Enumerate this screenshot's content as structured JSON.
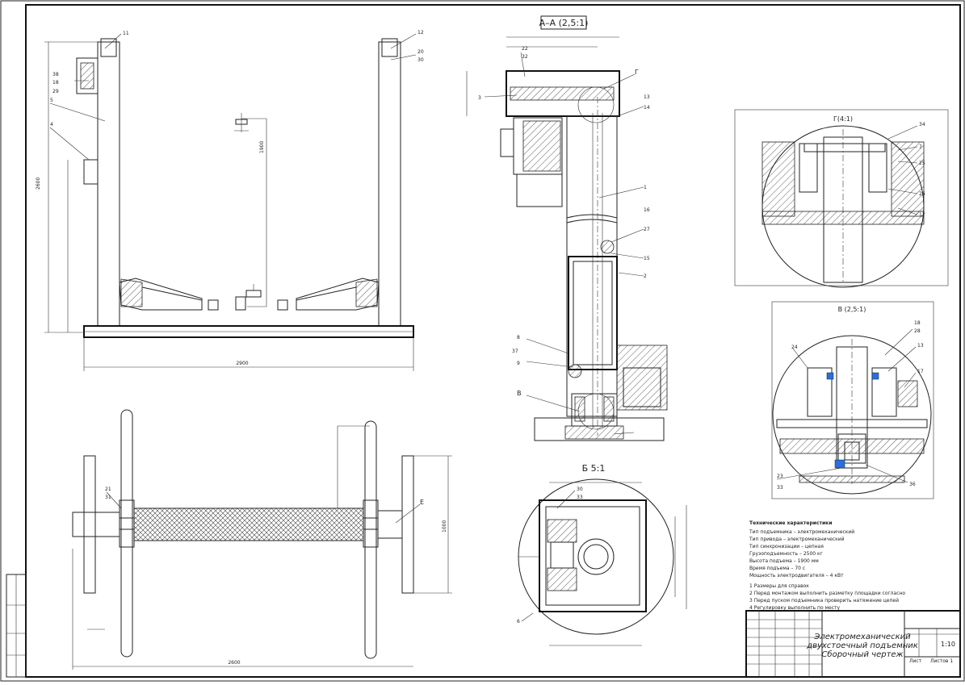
{
  "views": {
    "section_aa": "А–А (2,5:1)",
    "view_b_top": "Б 5:1",
    "detail_g": "Г(4:1)",
    "detail_v": "В (2,5:1)"
  },
  "leaders": [
    "11",
    "12",
    "20",
    "30",
    "38",
    "18",
    "29",
    "5",
    "4",
    "22",
    "32",
    "3",
    "Г",
    "13",
    "14",
    "1",
    "16",
    "27",
    "15",
    "2",
    "8",
    "37",
    "9",
    "В",
    "21",
    "31",
    "Е",
    "30",
    "33",
    "6",
    "34",
    "7",
    "25",
    "26",
    "17",
    "18",
    "28",
    "24",
    "13",
    "17",
    "23",
    "33",
    "36"
  ],
  "tech_text": {
    "heading": "Технические характеристики",
    "lines": [
      "Тип подъемника – электромеханический",
      "Тип привода – электромеханический",
      "Тип синхронизации – цепная",
      "Грузоподъемность – 2500 кг",
      "Высота подъема – 1900 мм",
      "Время подъема – 70 с",
      "Мощность электродвигателя – 4 кВт"
    ],
    "notes": [
      "1 Размеры для справок",
      "2 Перед монтажом выполнить разметку площадки согласно",
      "3 Перед пуском подъемника проверить натяжение цепей",
      "4 Регулировку выполнить по месту"
    ]
  },
  "title_block": {
    "name_line1": "Электромеханический",
    "name_line2": "двухстоечный подъемник",
    "name_line3": "Сборочный чертеж",
    "scale": "1:10",
    "letter": "",
    "sheet": "Лист",
    "sheets": "Листов 1"
  },
  "dims": {
    "total_width": "2900",
    "height": "2600",
    "lift": "1900",
    "plan_width": "2600",
    "plan_depth": "1000"
  }
}
